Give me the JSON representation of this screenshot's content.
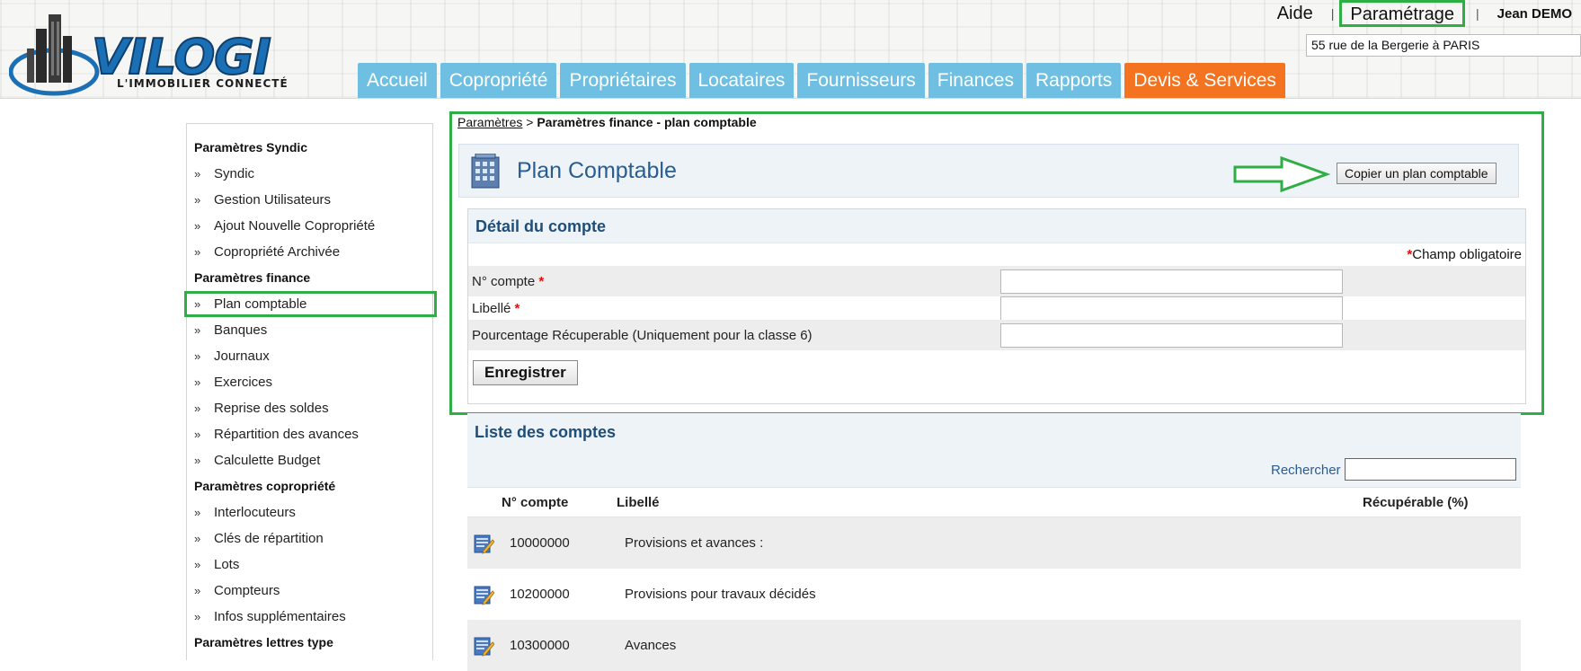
{
  "header": {
    "logo_text": "VILOGI",
    "logo_tagline": "L'IMMOBILIER CONNECTÉ",
    "top_links": {
      "aide": "Aide",
      "separator": "|",
      "parametrage": "Paramétrage",
      "user": "Jean DEMO"
    },
    "address": "55 rue de la Bergerie à PARIS",
    "nav_tabs": [
      {
        "label": "Accueil"
      },
      {
        "label": "Copropriété"
      },
      {
        "label": "Propriétaires"
      },
      {
        "label": "Locataires"
      },
      {
        "label": "Fournisseurs"
      },
      {
        "label": "Finances"
      },
      {
        "label": "Rapports"
      },
      {
        "label": "Devis & Services"
      }
    ],
    "colors": {
      "nav_tab": "#6fbfe2",
      "nav_accent": "#f37320",
      "highlight": "#2fae45",
      "logo_blue": "#1b6fb5"
    }
  },
  "sidebar": {
    "sections": [
      {
        "title": "Paramètres Syndic",
        "items": [
          "Syndic",
          "Gestion Utilisateurs",
          "Ajout Nouvelle Copropriété",
          "Copropriété Archivée"
        ]
      },
      {
        "title": "Paramètres finance",
        "items": [
          "Plan comptable",
          "Banques",
          "Journaux",
          "Exercices",
          "Reprise des soldes",
          "Répartition des avances",
          "Calculette Budget"
        ]
      },
      {
        "title": "Paramètres copropriété",
        "items": [
          "Interlocuteurs",
          "Clés de répartition",
          "Lots",
          "Compteurs",
          "Infos supplémentaires"
        ]
      },
      {
        "title": "Paramètres lettres type",
        "items": []
      }
    ],
    "active_item": "Plan comptable",
    "chevron": "»"
  },
  "breadcrumb": {
    "link": "Paramètres",
    "separator": ">",
    "current": "Paramètres finance - plan comptable"
  },
  "panel": {
    "title": "Plan Comptable",
    "copy_button": "Copier un plan comptable"
  },
  "detail": {
    "title": "Détail du compte",
    "required_star": "*",
    "required_note": "Champ obligatoire",
    "fields": [
      {
        "label": "N° compte",
        "required": "*",
        "value": ""
      },
      {
        "label": "Libellé",
        "required": "*",
        "value": ""
      },
      {
        "label": "Pourcentage Récuperable (Uniquement pour la classe 6)",
        "required": "",
        "value": ""
      }
    ],
    "save_button": "Enregistrer"
  },
  "list": {
    "title": "Liste des comptes",
    "search_label": "Rechercher",
    "search_value": "",
    "columns": {
      "num": "N° compte",
      "libelle": "Libellé",
      "recuperable": "Récupérable (%)"
    },
    "rows": [
      {
        "num": "10000000",
        "libelle": "Provisions et avances :",
        "recuperable": ""
      },
      {
        "num": "10200000",
        "libelle": "Provisions pour travaux décidés",
        "recuperable": ""
      },
      {
        "num": "10300000",
        "libelle": "Avances",
        "recuperable": ""
      }
    ]
  }
}
